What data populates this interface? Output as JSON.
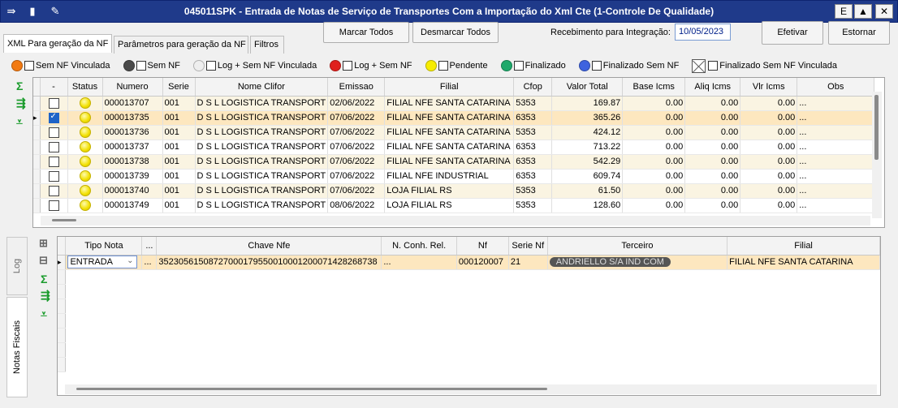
{
  "window": {
    "title": "045011SPK - Entrada de Notas de Serviço de Transportes Com a Importação do Xml Cte (1-Controle De Qualidade)",
    "icons": [
      "menu-arrow-icon",
      "traffic-light-icon",
      "wrench-icon"
    ],
    "buttons": [
      "E",
      "▲",
      "✕"
    ]
  },
  "tabs": [
    {
      "label": "XML Para geração da NF",
      "active": true
    },
    {
      "label": "Parâmetros para geração da NF",
      "active": false
    },
    {
      "label": "Filtros",
      "active": false
    }
  ],
  "toolbar": {
    "marcar_todos": "Marcar Todos",
    "desmarcar_todos": "Desmarcar Todos",
    "recebimento_label": "Recebimento para Integração:",
    "recebimento_value": "10/05/2023",
    "efetivar": "Efetivar",
    "estornar": "Estornar"
  },
  "legend": [
    {
      "label": "Sem NF Vinculada",
      "color": "#f27a12"
    },
    {
      "label": "Sem NF",
      "color": "#4a4a4a"
    },
    {
      "label": "Log + Sem NF Vinculada",
      "color": "#eeeeee"
    },
    {
      "label": "Log + Sem NF",
      "color": "#e0201d"
    },
    {
      "label": "Pendente",
      "color": "#f7ec00"
    },
    {
      "label": "Finalizado",
      "color": "#1fa96b"
    },
    {
      "label": "Finalizado Sem NF",
      "color": "#3e63df"
    },
    {
      "label": "Finalizado Sem NF Vinculada",
      "color": "none"
    }
  ],
  "upper_grid": {
    "columns": [
      "-",
      "Status",
      "Numero",
      "Serie",
      "Nome Clifor",
      "Emissao",
      "Filial",
      "Cfop",
      "Valor Total",
      "Base Icms",
      "Aliq Icms",
      "Vlr Icms",
      "Obs"
    ],
    "rows": [
      {
        "checked": false,
        "numero": "000013707",
        "serie": "001",
        "clifor": "D S L LOGISTICA TRANSPORT",
        "emissao": "02/06/2022",
        "filial": "FILIAL NFE SANTA CATARINA",
        "cfop": "5353",
        "valor": "169.87",
        "base": "0.00",
        "aliq": "0.00",
        "vlr": "0.00",
        "obs": "..."
      },
      {
        "checked": true,
        "selected": true,
        "numero": "000013735",
        "serie": "001",
        "clifor": "D S L LOGISTICA TRANSPORT",
        "emissao": "07/06/2022",
        "filial": "FILIAL NFE SANTA CATARINA",
        "cfop": "6353",
        "valor": "365.26",
        "base": "0.00",
        "aliq": "0.00",
        "vlr": "0.00",
        "obs": "..."
      },
      {
        "checked": false,
        "numero": "000013736",
        "serie": "001",
        "clifor": "D S L LOGISTICA TRANSPORT",
        "emissao": "07/06/2022",
        "filial": "FILIAL NFE SANTA CATARINA",
        "cfop": "5353",
        "valor": "424.12",
        "base": "0.00",
        "aliq": "0.00",
        "vlr": "0.00",
        "obs": "..."
      },
      {
        "checked": false,
        "numero": "000013737",
        "serie": "001",
        "clifor": "D S L LOGISTICA TRANSPORT",
        "emissao": "07/06/2022",
        "filial": "FILIAL NFE SANTA CATARINA",
        "cfop": "6353",
        "valor": "713.22",
        "base": "0.00",
        "aliq": "0.00",
        "vlr": "0.00",
        "obs": "..."
      },
      {
        "checked": false,
        "numero": "000013738",
        "serie": "001",
        "clifor": "D S L LOGISTICA TRANSPORT",
        "emissao": "07/06/2022",
        "filial": "FILIAL NFE SANTA CATARINA",
        "cfop": "6353",
        "valor": "542.29",
        "base": "0.00",
        "aliq": "0.00",
        "vlr": "0.00",
        "obs": "..."
      },
      {
        "checked": false,
        "numero": "000013739",
        "serie": "001",
        "clifor": "D S L LOGISTICA TRANSPORT",
        "emissao": "07/06/2022",
        "filial": "FILIAL NFE INDUSTRIAL",
        "cfop": "6353",
        "valor": "609.74",
        "base": "0.00",
        "aliq": "0.00",
        "vlr": "0.00",
        "obs": "..."
      },
      {
        "checked": false,
        "numero": "000013740",
        "serie": "001",
        "clifor": "D S L LOGISTICA TRANSPORT",
        "emissao": "07/06/2022",
        "filial": "LOJA FILIAL RS",
        "cfop": "5353",
        "valor": "61.50",
        "base": "0.00",
        "aliq": "0.00",
        "vlr": "0.00",
        "obs": "..."
      },
      {
        "checked": false,
        "numero": "000013749",
        "serie": "001",
        "clifor": "D S L LOGISTICA TRANSPORT",
        "emissao": "08/06/2022",
        "filial": "LOJA FILIAL RS",
        "cfop": "5353",
        "valor": "128.60",
        "base": "0.00",
        "aliq": "0.00",
        "vlr": "0.00",
        "obs": "..."
      }
    ]
  },
  "side_tabs": {
    "log": "Log",
    "notas": "Notas Fiscais"
  },
  "lower_grid": {
    "columns": [
      "Tipo Nota",
      "...",
      "Chave Nfe",
      "N. Conh. Rel.",
      "Nf",
      "Serie Nf",
      "Terceiro",
      "Filial"
    ],
    "rows": [
      {
        "tipo": "ENTRADA",
        "dots": "...",
        "chave": "35230561508727000179550010001200071428268738",
        "conh": "...",
        "nf": "000120007",
        "serie": "21",
        "terceiro": "ANDRIELLO S/A IND COM",
        "filial": "FILIAL NFE SANTA CATARINA"
      }
    ]
  }
}
